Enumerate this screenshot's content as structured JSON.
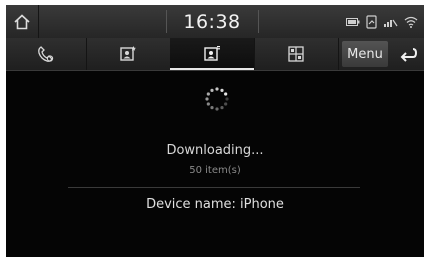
{
  "status_bar": {
    "time": "16:38",
    "icons": [
      "home-icon",
      "battery-icon",
      "phone-signal-icon",
      "bluetooth-phone-icon",
      "wifi-icon"
    ]
  },
  "tabs": [
    {
      "name": "recent-calls-icon",
      "active": false
    },
    {
      "name": "favorites-icon",
      "active": false
    },
    {
      "name": "contacts-icon",
      "active": true
    },
    {
      "name": "dial-pad-icon",
      "active": false
    }
  ],
  "toolbar": {
    "menu_label": "Menu",
    "back_icon": "back-arrow-icon"
  },
  "content": {
    "status_text": "Downloading...",
    "count_text": "50 item(s)",
    "device_text": "Device name: iPhone"
  },
  "colors": {
    "background": "#050505",
    "bar": "#2f2f2f",
    "text": "#e0e0e0"
  }
}
